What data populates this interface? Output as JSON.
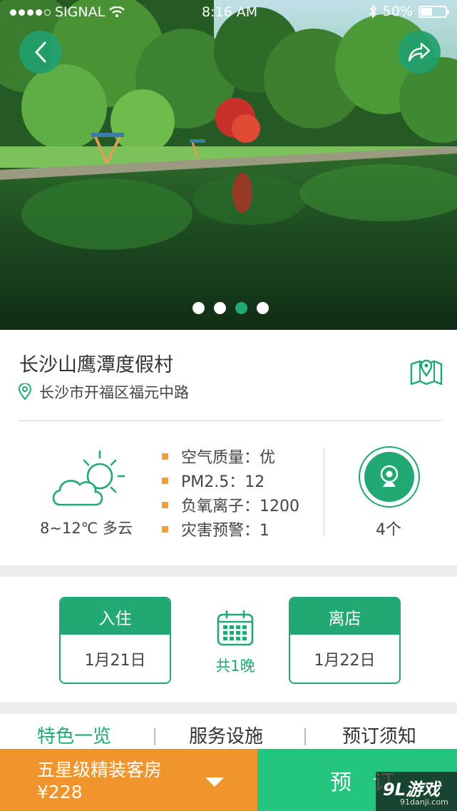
{
  "status_bar": {
    "carrier": "SIGNAL",
    "time": "8:16 AM",
    "battery": "50%",
    "signal_icon": "signal-dots-icon",
    "wifi_icon": "wifi-icon",
    "bluetooth_icon": "bluetooth-icon"
  },
  "hero": {
    "photo_subject": "lake-forest-photo",
    "pages": 4,
    "active_page": 3
  },
  "hotel": {
    "name": "长沙山鹰潭度假村",
    "address": "长沙市开福区福元中路"
  },
  "weather": {
    "condition": "8~12℃  多云",
    "metrics": [
      {
        "label": "空气质量：优"
      },
      {
        "label": "PM2.5：12"
      },
      {
        "label": "负氧离子：1200"
      },
      {
        "label": "灾害预警：1"
      }
    ],
    "camera_count": "4个"
  },
  "stay": {
    "checkin_label": "入住",
    "checkin_date": "1月21日",
    "checkout_label": "离店",
    "checkout_date": "1月22日",
    "nights": "共1晚"
  },
  "tabs": [
    {
      "label": "特色一览",
      "active": true
    },
    {
      "label": "服务设施",
      "active": false
    },
    {
      "label": "预订须知",
      "active": false
    }
  ],
  "booking": {
    "room_type": "五星级精装客房",
    "price": "¥228",
    "book_label": "预订"
  },
  "watermark": {
    "logo": "9L游戏",
    "url": "91danji.com"
  },
  "colors": {
    "primary_green": "#21a873",
    "book_green": "#23c57f",
    "orange": "#f0942c",
    "bullet_orange": "#f0a030"
  }
}
